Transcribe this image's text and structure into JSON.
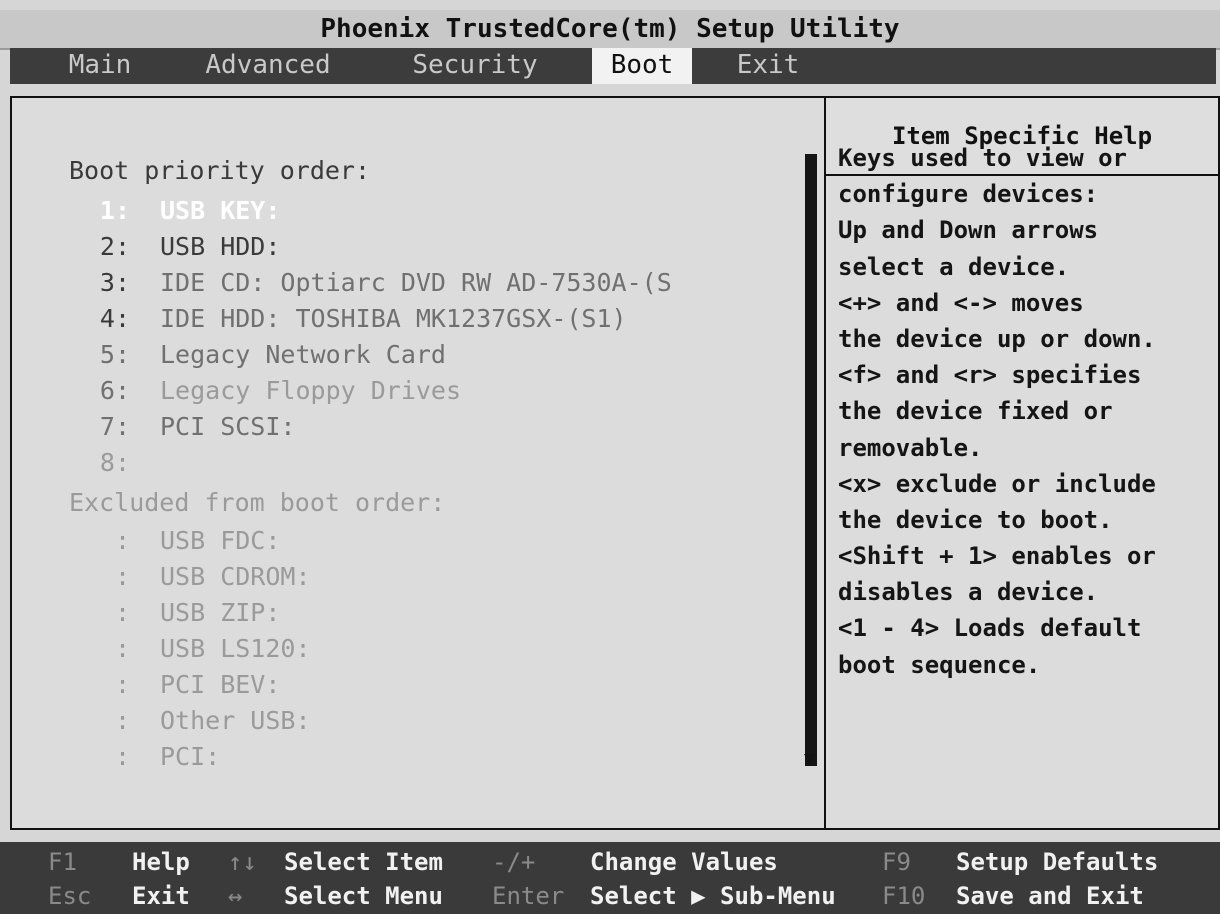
{
  "title": "Phoenix TrustedCore(tm) Setup Utility",
  "menu": {
    "items": [
      {
        "label": "Main"
      },
      {
        "label": "Advanced"
      },
      {
        "label": "Security"
      },
      {
        "label": "Boot"
      },
      {
        "label": "Exit"
      }
    ],
    "active": "Boot"
  },
  "boot": {
    "priority_label": "Boot priority order:",
    "priority_items": [
      {
        "num": "1:",
        "device": "USB KEY:"
      },
      {
        "num": "2:",
        "device": "USB HDD:"
      },
      {
        "num": "3:",
        "device": "IDE CD: Optiarc DVD RW AD-7530A-(S"
      },
      {
        "num": "4:",
        "device": "IDE HDD: TOSHIBA MK1237GSX-(S1)"
      },
      {
        "num": "5:",
        "device": "Legacy Network Card"
      },
      {
        "num": "6:",
        "device": "Legacy Floppy Drives"
      },
      {
        "num": "7:",
        "device": "PCI SCSI:"
      },
      {
        "num": "8:",
        "device": ""
      }
    ],
    "excluded_label": "Excluded from boot order:",
    "excluded_items": [
      {
        "num": ":",
        "device": "USB FDC:"
      },
      {
        "num": ":",
        "device": "USB CDROM:"
      },
      {
        "num": ":",
        "device": "USB ZIP:"
      },
      {
        "num": ":",
        "device": "USB LS120:"
      },
      {
        "num": ":",
        "device": "PCI BEV:"
      },
      {
        "num": ":",
        "device": "Other USB:"
      },
      {
        "num": ":",
        "device": "PCI:"
      }
    ]
  },
  "help": {
    "title": "Item Specific Help",
    "lines": [
      "Keys used to view or",
      "configure devices:",
      "Up and Down arrows",
      "select a device.",
      "<+> and <-> moves",
      "the device up or down.",
      "<f> and <r> specifies",
      "the device fixed or",
      "removable.",
      "<x> exclude or include",
      "the device to boot.",
      "<Shift + 1> enables or",
      "disables a device.",
      "<1 - 4> Loads default",
      "boot sequence."
    ]
  },
  "keys": {
    "row1": [
      {
        "key": "F1",
        "desc": "Help"
      },
      {
        "key": "↑↓",
        "desc": "Select Item"
      },
      {
        "key": "-/+",
        "desc": "Change Values"
      },
      {
        "key": "F9",
        "desc": "Setup Defaults"
      }
    ],
    "row2": [
      {
        "key": "Esc",
        "desc": "Exit"
      },
      {
        "key": "↔",
        "desc": "Select Menu"
      },
      {
        "key": "Enter",
        "desc": "Select ▶ Sub-Menu"
      },
      {
        "key": "F10",
        "desc": "Save and Exit"
      }
    ]
  },
  "colors": {
    "menu_bar": "#3c3c3c",
    "active_tab": "#f2f2f2",
    "selected_item": "#ffffff"
  }
}
